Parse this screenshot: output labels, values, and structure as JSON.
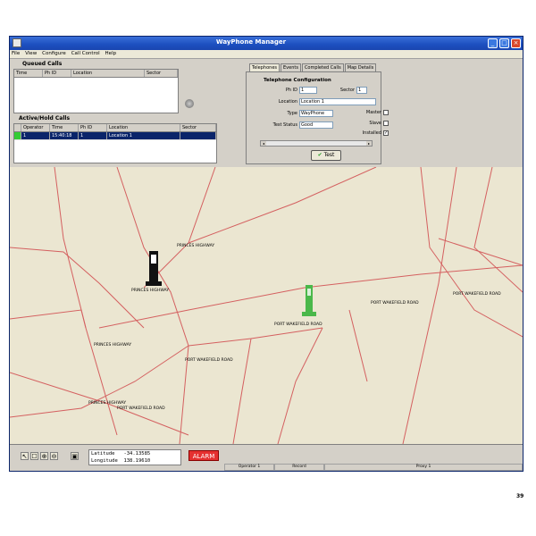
{
  "window": {
    "title": "WayPhone Manager"
  },
  "menu": [
    "File",
    "View",
    "Configure",
    "Call Control",
    "Help"
  ],
  "queued_calls": {
    "title": "Queued Calls",
    "columns": [
      "Time",
      "Ph ID",
      "Location",
      "Sector"
    ],
    "rows": []
  },
  "active_calls": {
    "title": "Active/Hold Calls",
    "columns": [
      "",
      "Operator",
      "Time",
      "Ph ID",
      "Location",
      "Sector"
    ],
    "rows": [
      {
        "operator": "1",
        "time": "15:40:18",
        "ph_id": "1",
        "location": "Location 1",
        "sector": ""
      }
    ]
  },
  "tabs": [
    "Telephones",
    "Events",
    "Completed Calls",
    "Map Details"
  ],
  "telephone_config": {
    "title": "Telephone Configuration",
    "ph_id_label": "Ph ID",
    "ph_id": "1",
    "sector_label": "Sector",
    "sector": "1",
    "location_label": "Location",
    "location": "Location 1",
    "type_label": "Type",
    "type": "WayPhone",
    "test_status_label": "Test Status",
    "test_status": "Good",
    "master_label": "Master",
    "slave_label": "Slave",
    "installed_label": "Installed",
    "installed_checked": "✓",
    "test_button": "Test"
  },
  "map": {
    "labels": [
      "PRINCES HIGHWAY",
      "PRINCES HIGHWAY",
      "PRINCES HIGHWAY",
      "PRINCES HIGHWAY",
      "PORT WAKEFIELD ROAD",
      "PORT WAKEFIELD ROAD",
      "PORT WAKEFIELD ROAD",
      "PORT WAKEFIELD ROAD",
      "PORT WAKEFIELD ROAD"
    ]
  },
  "status": {
    "latitude_label": "Latitude",
    "latitude": "-34.13585",
    "longitude_label": "Longitude",
    "longitude": "138.19610",
    "alarm": "ALARM",
    "operator": "Operator 1",
    "record": "Record",
    "proxy": "Proxy 1"
  },
  "page_number": "39",
  "colors": {
    "titlebar": "#1c4fbf",
    "road": "#d46060",
    "map_bg": "#ebe6d1",
    "alarm": "#e53030",
    "phone_active": "#4ab84a",
    "phone_idle": "#111111"
  },
  "icons": [
    "pointer-icon",
    "pan-icon",
    "zoom-in-icon",
    "zoom-out-icon",
    "select-icon",
    "check-icon",
    "speaker-icon"
  ]
}
